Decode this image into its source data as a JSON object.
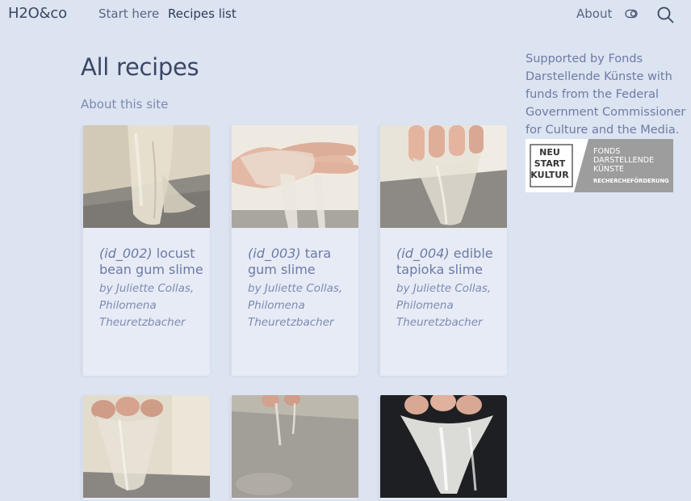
{
  "header": {
    "brand": "H2O&co",
    "nav": {
      "start_here": "Start here",
      "recipes_list": "Recipes list",
      "about": "About"
    },
    "icons": {
      "theme": "theme-toggle-icon",
      "search": "search-icon"
    }
  },
  "main": {
    "title": "All recipes",
    "about_link": "About this site",
    "recipes": [
      {
        "id": "(id_002)",
        "name": "locust bean gum slime",
        "authors": "by Juliette Collas, Philomena Theuretzbacher"
      },
      {
        "id": "(id_003)",
        "name": "tara gum slime",
        "authors": "by Juliette Collas, Philomena Theuretzbacher"
      },
      {
        "id": "(id_004)",
        "name": "edible tapioka slime",
        "authors": "by Juliette Collas, Philomena Theuretzbacher"
      }
    ]
  },
  "sidebar": {
    "sponsor_text": "Supported by Fonds Darstellende Künste with funds from the Federal Government Commissioner for Culture and the Media.",
    "logo": {
      "line1": "NEU",
      "line2": "START",
      "line3": "KULTUR",
      "fonds1": "FONDS",
      "fonds2": "DARSTELLENDE",
      "fonds3": "KÜNSTE",
      "sub": "RECHERCHEFÖRDERUNG"
    }
  },
  "colors": {
    "background": "#dce3f1",
    "card": "#e6ebf6",
    "link": "#6d7aa3",
    "heading": "#3b4766"
  }
}
